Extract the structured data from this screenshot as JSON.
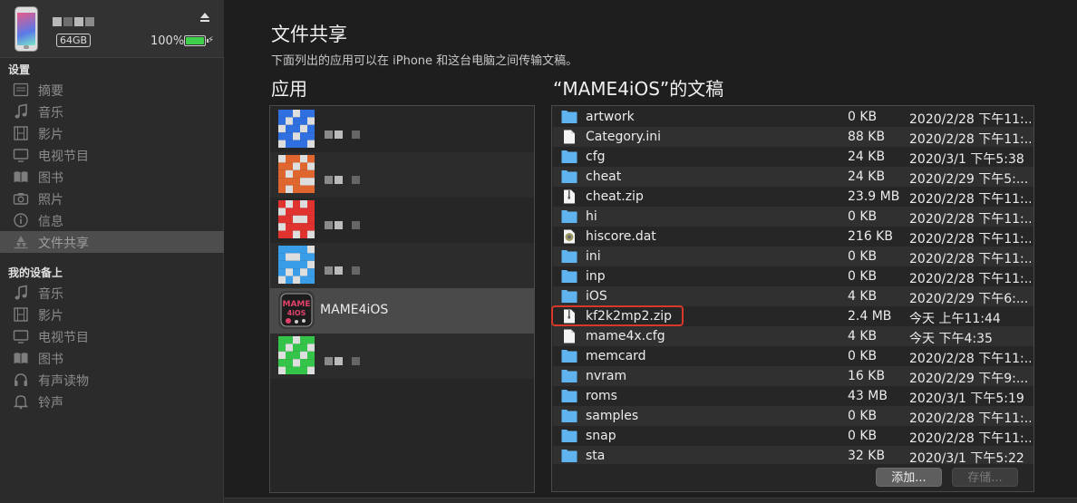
{
  "device": {
    "capacity": "64GB",
    "battery": "100%",
    "charging_glyph": "⚡",
    "battery_color": "#3fd04b"
  },
  "sidebar": {
    "settings_title": "设置",
    "settings_items": [
      {
        "label": "摘要",
        "icon": "summary-icon"
      },
      {
        "label": "音乐",
        "icon": "music-icon"
      },
      {
        "label": "影片",
        "icon": "film-icon"
      },
      {
        "label": "电视节目",
        "icon": "tv-icon"
      },
      {
        "label": "图书",
        "icon": "book-icon"
      },
      {
        "label": "照片",
        "icon": "camera-icon"
      },
      {
        "label": "信息",
        "icon": "info-icon"
      },
      {
        "label": "文件共享",
        "icon": "apps-icon",
        "selected": true
      }
    ],
    "ondevice_title": "我的设备上",
    "ondevice_items": [
      {
        "label": "音乐",
        "icon": "music-icon"
      },
      {
        "label": "影片",
        "icon": "film-icon"
      },
      {
        "label": "电视节目",
        "icon": "tv-icon"
      },
      {
        "label": "图书",
        "icon": "book-icon"
      },
      {
        "label": "有声读物",
        "icon": "headphones-icon"
      },
      {
        "label": "铃声",
        "icon": "bell-icon"
      }
    ]
  },
  "main": {
    "title": "文件共享",
    "description": "下面列出的应用可以在 iPhone 和这台电脑之间传输文稿。",
    "apps_title": "应用",
    "docs_title": "“MAME4iOS”的文稿"
  },
  "apps": [
    {
      "name": "",
      "color": "#2f6fe0",
      "blurred": true
    },
    {
      "name": "",
      "color": "#e0662f",
      "blurred": true
    },
    {
      "name": "",
      "color": "#e0332f",
      "blurred": true
    },
    {
      "name": "",
      "color": "#3a9de8",
      "blurred": true
    },
    {
      "name": "MAME4iOS",
      "color": "#d23a5a",
      "blurred": false,
      "selected": true
    },
    {
      "name": "",
      "color": "#35c44a",
      "blurred": true
    }
  ],
  "files": [
    {
      "name": "artwork",
      "size": "0 KB",
      "date": "2020/2/28 下午11:...",
      "type": "folder"
    },
    {
      "name": "Category.ini",
      "size": "88 KB",
      "date": "2020/2/28 下午11:...",
      "type": "doc"
    },
    {
      "name": "cfg",
      "size": "24 KB",
      "date": "2020/3/1 下午5:38",
      "type": "folder"
    },
    {
      "name": "cheat",
      "size": "24 KB",
      "date": "2020/2/29 下午5:...",
      "type": "folder"
    },
    {
      "name": "cheat.zip",
      "size": "23.9 MB",
      "date": "2020/2/28 下午11:...",
      "type": "zip"
    },
    {
      "name": "hi",
      "size": "0 KB",
      "date": "2020/2/28 下午11:...",
      "type": "folder"
    },
    {
      "name": "hiscore.dat",
      "size": "216 KB",
      "date": "2020/2/28 下午11:...",
      "type": "dat"
    },
    {
      "name": "ini",
      "size": "0 KB",
      "date": "2020/2/28 下午11:...",
      "type": "folder"
    },
    {
      "name": "inp",
      "size": "0 KB",
      "date": "2020/2/28 下午11:...",
      "type": "folder"
    },
    {
      "name": "iOS",
      "size": "4 KB",
      "date": "2020/2/29 下午6:...",
      "type": "folder"
    },
    {
      "name": "kf2k2mp2.zip",
      "size": "2.4 MB",
      "date": "今天 上午11:44",
      "type": "zip",
      "highlighted": true
    },
    {
      "name": "mame4x.cfg",
      "size": "4 KB",
      "date": "今天 下午4:35",
      "type": "doc"
    },
    {
      "name": "memcard",
      "size": "0 KB",
      "date": "2020/2/28 下午11:...",
      "type": "folder"
    },
    {
      "name": "nvram",
      "size": "16 KB",
      "date": "2020/2/29 下午9:...",
      "type": "folder"
    },
    {
      "name": "roms",
      "size": "43 MB",
      "date": "2020/3/1 下午5:19",
      "type": "folder"
    },
    {
      "name": "samples",
      "size": "0 KB",
      "date": "2020/2/28 下午11:...",
      "type": "folder"
    },
    {
      "name": "snap",
      "size": "0 KB",
      "date": "2020/2/28 下午11:...",
      "type": "folder"
    },
    {
      "name": "sta",
      "size": "32 KB",
      "date": "2020/3/1 下午5:22",
      "type": "folder"
    }
  ],
  "footer": {
    "add_label": "添加...",
    "save_label": "存储..."
  },
  "colors": {
    "folder": "#5fb3ee",
    "highlight_border": "#d6382a",
    "selected_row": "#4a4a4a"
  }
}
